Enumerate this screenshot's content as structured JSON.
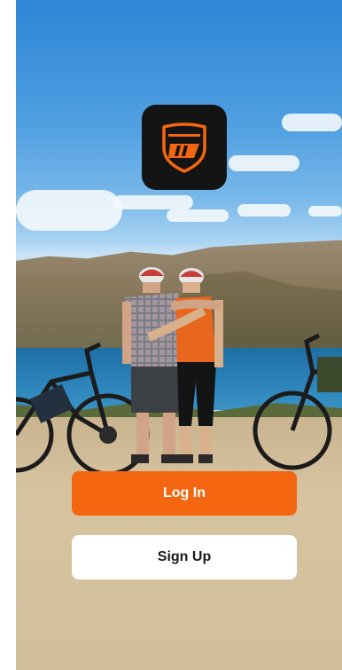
{
  "login": {
    "label": "Log In",
    "color": "#f4660f"
  },
  "signup": {
    "label": "Sign Up",
    "color": "#ffffff"
  },
  "logo": {
    "icon": "brand-shield-logo-icon",
    "background": "#141414",
    "accent": "#f4660f"
  },
  "background": {
    "description_icon": "ebike-couple-photo"
  }
}
